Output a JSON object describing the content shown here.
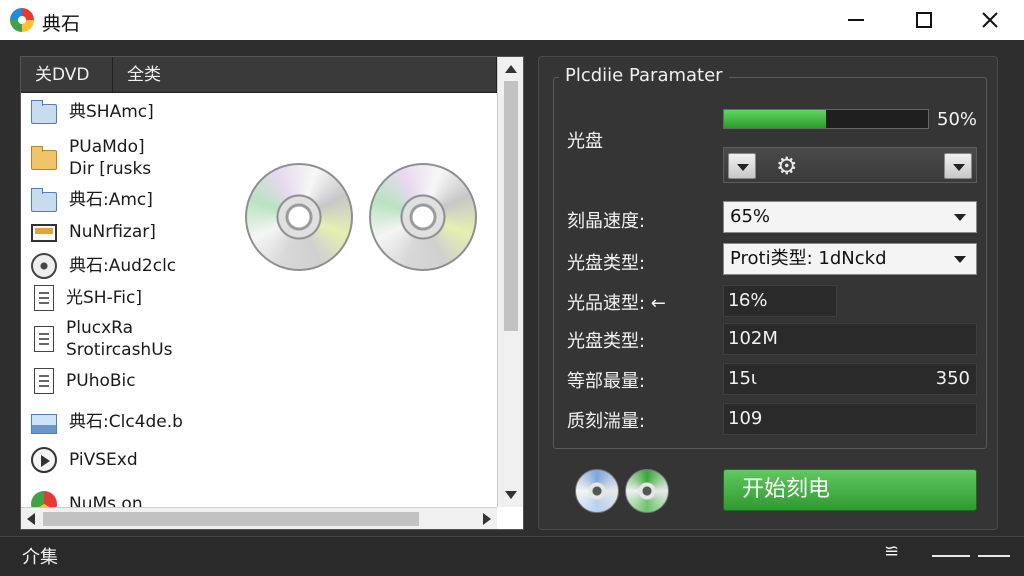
{
  "window": {
    "title": "典石"
  },
  "left_panel": {
    "tabs": [
      "关DVD",
      "全类"
    ],
    "files": [
      {
        "label": "典SHAmc]",
        "icon": "folder-blue-icon"
      },
      {
        "label": "PUaMdo]\nDir [rusks",
        "icon": "folder-gold-icon"
      },
      {
        "label": "典石:Amc]",
        "icon": "folder-blue-icon"
      },
      {
        "label": "NuNrfizar]",
        "icon": "monitor-icon"
      },
      {
        "label": "典石:Aud2clc",
        "icon": "audio-icon"
      },
      {
        "label": "光SH-Fic]",
        "icon": "document-icon"
      },
      {
        "label": "PlucxRa\nSrotircashUs",
        "icon": "document-icon"
      },
      {
        "label": "PUhoBic",
        "icon": "document-icon"
      },
      {
        "label": "典石:Clc4de.b",
        "icon": "image-icon"
      },
      {
        "label": "PiVSExd",
        "icon": "play-icon"
      },
      {
        "label": "NuMs.on",
        "icon": "chrome-icon"
      }
    ]
  },
  "params": {
    "title": "Plcdiie Paramater",
    "disc_label": "光盘",
    "progress": {
      "value": 0.5,
      "text": "50%"
    },
    "burn_speed": {
      "label": "刻晶速度:",
      "value": "65%"
    },
    "disc_type": {
      "label": "光盘类型:",
      "value": "Proti类型: 1dNckd"
    },
    "disc_speed": {
      "label": "光品速型: ←",
      "value": "1Ꮾ%"
    },
    "disc_type2": {
      "label": "光盘类型:",
      "value": "102M"
    },
    "capacity": {
      "label": "等部最量:",
      "value_left": "15ι",
      "value_right": "350"
    },
    "burn_amount": {
      "label": "质刻湍量:",
      "value": "109"
    },
    "start_button": "开始刻电"
  },
  "status": {
    "text": "介集",
    "icon_glyph": "≌"
  },
  "colors": {
    "accent_green": "#2e9b2e",
    "panel_dark": "#353535"
  }
}
